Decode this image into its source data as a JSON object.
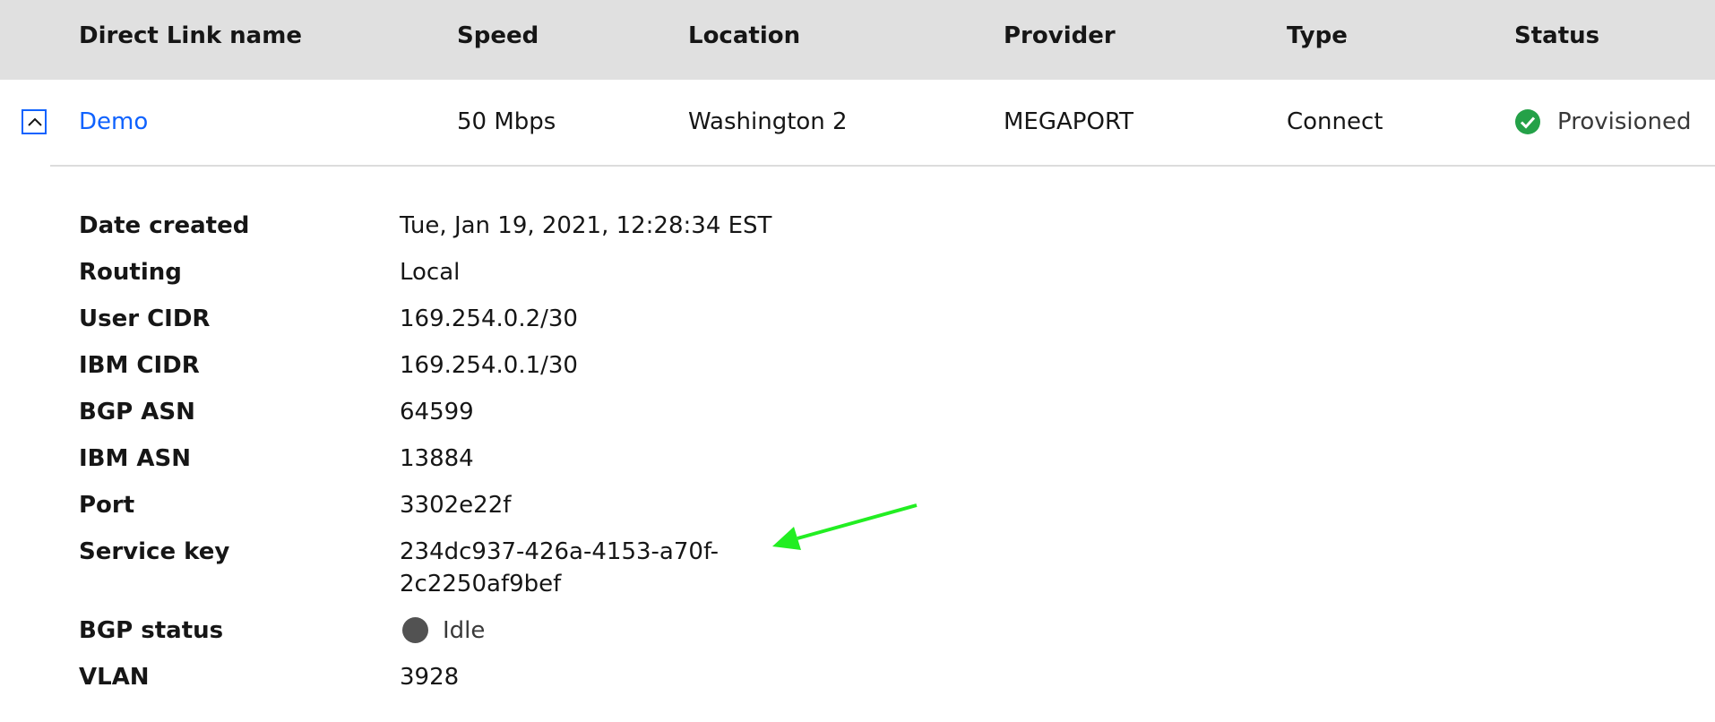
{
  "table": {
    "headers": {
      "name": "Direct Link name",
      "speed": "Speed",
      "location": "Location",
      "provider": "Provider",
      "type": "Type",
      "status": "Status"
    },
    "row": {
      "name": "Demo",
      "speed": "50 Mbps",
      "location": "Washington 2",
      "provider": "MEGAPORT",
      "type": "Connect",
      "status": "Provisioned"
    }
  },
  "details": {
    "date_created": {
      "label": "Date created",
      "value": "Tue, Jan 19, 2021, 12:28:34 EST"
    },
    "routing": {
      "label": "Routing",
      "value": "Local"
    },
    "user_cidr": {
      "label": "User CIDR",
      "value": "169.254.0.2/30"
    },
    "ibm_cidr": {
      "label": "IBM CIDR",
      "value": "169.254.0.1/30"
    },
    "bgp_asn": {
      "label": "BGP ASN",
      "value": "64599"
    },
    "ibm_asn": {
      "label": "IBM ASN",
      "value": "13884"
    },
    "port": {
      "label": "Port",
      "value": "3302e22f"
    },
    "service_key": {
      "label": "Service key",
      "value_line1": "234dc937-426a-4153-a70f-",
      "value_line2": "2c2250af9bef"
    },
    "bgp_status": {
      "label": "BGP status",
      "value": "Idle"
    },
    "vlan": {
      "label": "VLAN",
      "value": "3928"
    }
  },
  "icons": {
    "expand": "chevron-up-icon",
    "status": "checkmark-filled-icon",
    "bgp_status": "idle-circle-icon",
    "annotation": "arrow-icon"
  },
  "colors": {
    "header_bg": "#e0e0e0",
    "link": "#0f62fe",
    "success": "#24a148",
    "idle": "#525252",
    "annotation_arrow": "#22ee22"
  }
}
